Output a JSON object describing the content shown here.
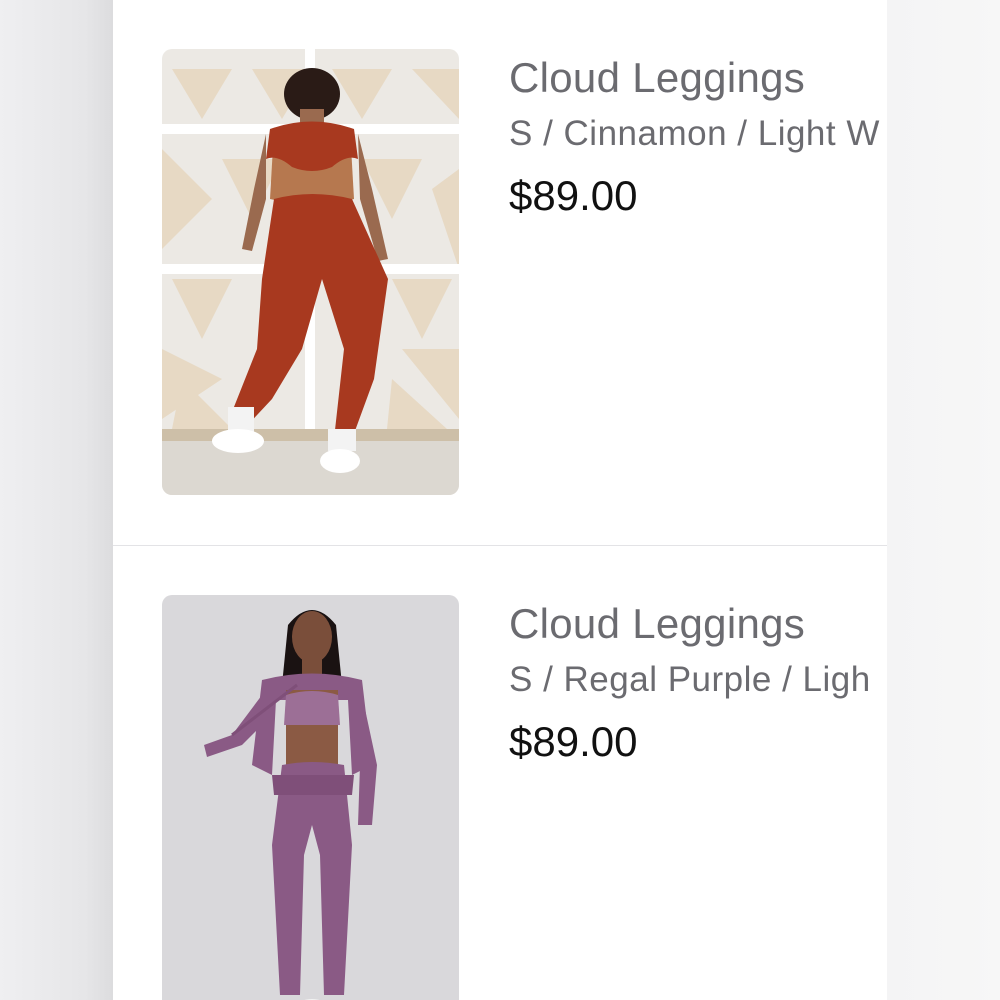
{
  "cart": {
    "items": [
      {
        "title": "Cloud Leggings",
        "variant": "S / Cinnamon / Light W",
        "price": "$89.00",
        "image_icon": "product-photo-cinnamon"
      },
      {
        "title": "Cloud Leggings",
        "variant": "S / Regal Purple / Ligh",
        "price": "$89.00",
        "image_icon": "product-photo-regal-purple"
      }
    ]
  },
  "colors": {
    "cinnamon": "#a8391f",
    "regal_purple": "#8a5a85",
    "title_gray": "#6b6b70",
    "price_black": "#111111"
  }
}
